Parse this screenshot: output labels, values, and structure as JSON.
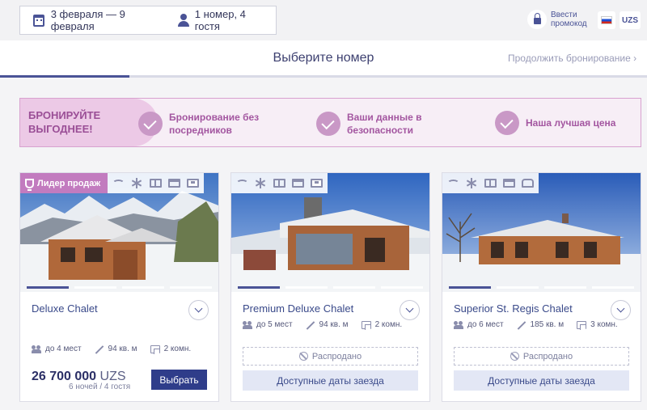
{
  "header": {
    "dates": "3 февраля — 9 февраля",
    "guests": "1 номер, 4 гостя",
    "promo_label": "Ввести промокод",
    "language": "RU",
    "currency": "UZS"
  },
  "step": {
    "title": "Выберите номер",
    "next_label": "Продолжить бронирование",
    "progress": 0.2
  },
  "banner": {
    "headline": "БРОНИРУЙТЕ ВЫГОДНЕЕ!",
    "items": [
      {
        "label": "Бронирование без посредников"
      },
      {
        "label": "Ваши данные в безопасности"
      },
      {
        "label": "Наша лучшая цена"
      }
    ]
  },
  "rooms": [
    {
      "name": "Deluxe Chalet",
      "badge": "Лидер продаж",
      "guests": "до 4 мест",
      "area": "94 кв. м",
      "rooms": "2 комн.",
      "price": "26 700 000",
      "currency": "UZS",
      "nights": "6 ночей / 4 гостя",
      "action": "Выбрать",
      "amenities": [
        "wifi-icon",
        "snowflake-icon",
        "book-icon",
        "bed-icon",
        "tv-icon"
      ]
    },
    {
      "name": "Premium Deluxe Chalet",
      "guests": "до 5 мест",
      "area": "94 кв. м",
      "rooms": "2 комн.",
      "status": "Распродано",
      "action": "Доступные даты заезда",
      "amenities": [
        "wifi-icon",
        "snowflake-icon",
        "book-icon",
        "bed-icon",
        "tv-icon"
      ]
    },
    {
      "name": "Superior St. Regis Chalet",
      "guests": "до 6 мест",
      "area": "185 кв. м",
      "rooms": "3 комн.",
      "status": "Распродано",
      "action": "Доступные даты заезда",
      "amenities": [
        "wifi-icon",
        "snowflake-icon",
        "book-icon",
        "bed-icon",
        "phone-icon"
      ]
    }
  ],
  "colors": {
    "brand": "#2f3d8a",
    "accent": "#c27bbf",
    "banner_bg": "#f7eef6"
  }
}
